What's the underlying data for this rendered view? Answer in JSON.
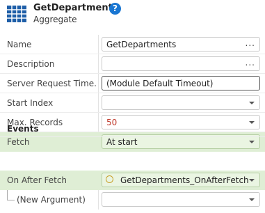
{
  "header": {
    "title": "GetDepartments",
    "subtitle": "Aggregate",
    "icon": "aggregate-grid-icon",
    "help_icon": "help-icon",
    "help_glyph": "?"
  },
  "properties": [
    {
      "label": "Name",
      "value": "GetDepartments",
      "control": "text-ellipsis"
    },
    {
      "label": "Description",
      "value": "",
      "control": "text-ellipsis"
    },
    {
      "label": "Server Request Time...",
      "value": "(Module Default Timeout)",
      "control": "text"
    },
    {
      "label": "Start Index",
      "value": "",
      "control": "dropdown"
    },
    {
      "label": "Max. Records",
      "value": "50",
      "control": "dropdown"
    },
    {
      "label": "Fetch",
      "value": "At start",
      "control": "dropdown"
    }
  ],
  "events": {
    "section_label": "Events",
    "items": [
      {
        "label": "On After Fetch",
        "value": "GetDepartments_OnAfterFetch",
        "control": "dropdown"
      },
      {
        "label": "(New Argument)",
        "value": "",
        "control": "dropdown"
      }
    ]
  },
  "ellipsis_glyph": "...",
  "colors": {
    "highlight_row": "#dfeed5",
    "help_blue": "#1976d2",
    "grid_icon_blue": "#1f5fa8",
    "max_records_value": "#c0392b"
  }
}
